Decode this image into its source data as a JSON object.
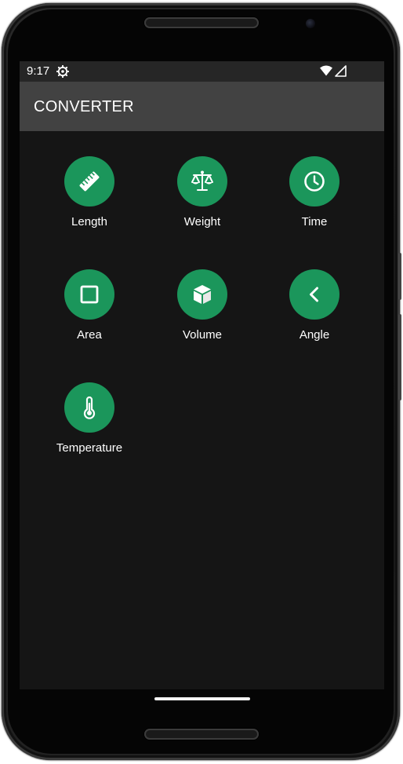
{
  "status_bar": {
    "time": "9:17",
    "icons": [
      "settings-gear-icon",
      "wifi-icon",
      "cell-signal-icon"
    ]
  },
  "app_bar": {
    "title": "CONVERTER",
    "background_color": "#424242"
  },
  "accent_color": "#1b965b",
  "categories": [
    {
      "label": "Length",
      "icon": "ruler-icon"
    },
    {
      "label": "Weight",
      "icon": "scale-icon"
    },
    {
      "label": "Time",
      "icon": "clock-icon"
    },
    {
      "label": "Area",
      "icon": "square-icon"
    },
    {
      "label": "Volume",
      "icon": "cube-icon"
    },
    {
      "label": "Angle",
      "icon": "angle-icon"
    },
    {
      "label": "Temperature",
      "icon": "thermometer-icon"
    }
  ]
}
